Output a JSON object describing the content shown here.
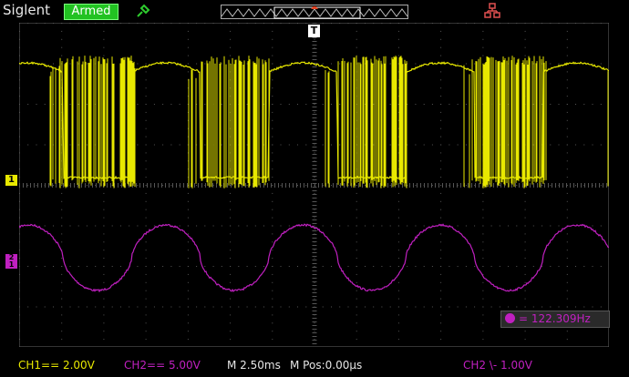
{
  "header": {
    "brand": "Siglent",
    "status": "Armed",
    "probe_icon": "probe-icon",
    "network_icon": "network-icon"
  },
  "screen": {
    "trigger_marker": "T",
    "ch1_marker": "1",
    "ch2_marker_top": "2",
    "ch2_marker_bottom": "1"
  },
  "measurement": {
    "label": "= 122.309Hz",
    "source": "2"
  },
  "footer": {
    "ch1": "CH1== 2.00V",
    "ch2": "CH2== 5.00V",
    "timebase": "M 2.50ms",
    "mpos": "M Pos:0.00µs",
    "trigger": "CH2 \\- 1.00V"
  },
  "colors": {
    "ch1": "#e8e800",
    "ch2": "#c020c0",
    "grid": "#555555",
    "status_bg": "#22c222"
  },
  "chart_data": {
    "type": "line",
    "series": [
      {
        "name": "CH1",
        "values": []
      },
      {
        "name": "CH2",
        "values": []
      }
    ],
    "x_divisions": 14,
    "y_divisions": 8,
    "ch2_periods_on_screen": 4.3
  }
}
